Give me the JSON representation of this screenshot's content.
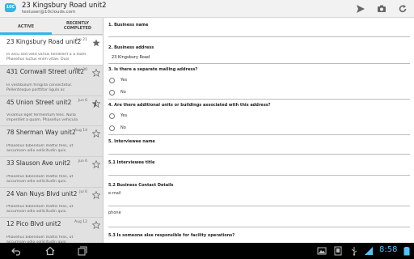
{
  "app": {
    "title": "23 Kingsbury Road unit2",
    "account": "testuser@10clouds.com",
    "icon_label": "10C"
  },
  "tabs": {
    "active": "ACTIVE",
    "completed_line1": "RECENTLY",
    "completed_line2": "COMPLETED"
  },
  "list": [
    {
      "title": "23 Kingsbury Road unit2",
      "date": "Jun 21",
      "desc": "In arcu sed velit varius hendrerit a a diam. Phasellus luctus enim vitae. Duis",
      "starred": true
    },
    {
      "title": "431 Cornwall Street unit2",
      "date": "May 30",
      "desc": "In vestibulum fringilla consectetur. Pellentesque porttitor ligula ac",
      "starred": false
    },
    {
      "title": "45 Union Street unit2",
      "date": "Jun 6",
      "desc": "Vivamus eget fermentum felis. Nulla imperdiet a quam. Phasellus vehicula",
      "starred": true
    },
    {
      "title": "78 Sherman Way unit2",
      "date": "Aug 14",
      "desc": "Phasellus bibendum mattis felis, ut accumsan odio sollicitudin quis.",
      "starred": false
    },
    {
      "title": "33 Slauson Ave unit2",
      "date": "Jun 6",
      "desc": "Phasellus bibendum mattis felis, ut accumsan odio sollicitudin quis.",
      "starred": false
    },
    {
      "title": "24 Van Nuys Blvd unit2",
      "date": "Jul 6",
      "desc": "Phasellus bibendum mattis felis, ut accumsan odio sollicitudin quis.",
      "starred": false
    },
    {
      "title": "12 Pico Blvd unit2",
      "date": "Aug 12",
      "desc": "Phasellus bibendum mattis felis, ut accumsan odio sollicitudin quis.",
      "starred": false
    }
  ],
  "form": {
    "q1": "1. Business name",
    "q2": "2. Business address",
    "q2_value": "23 Kingsbury Road",
    "q3": "3. Is there a separate mailing address?",
    "q3_yes": "Yes",
    "q3_no": "No",
    "q4": "4. Are there additional units or buildings associated with this address?",
    "q4_yes": "Yes",
    "q4_no": "No",
    "q5": "5. Interviewee name",
    "q51": "5.1 Interviewee title",
    "q52": "5.2 Business Contact Details",
    "q52_email": "e-mail",
    "q52_phone": "phone",
    "q53": "5.3 Is someone else responsible for facility operations?"
  },
  "status": {
    "time": "8:58"
  },
  "colors": {
    "accent": "#33b5e5",
    "clock": "#4fc3f7"
  }
}
